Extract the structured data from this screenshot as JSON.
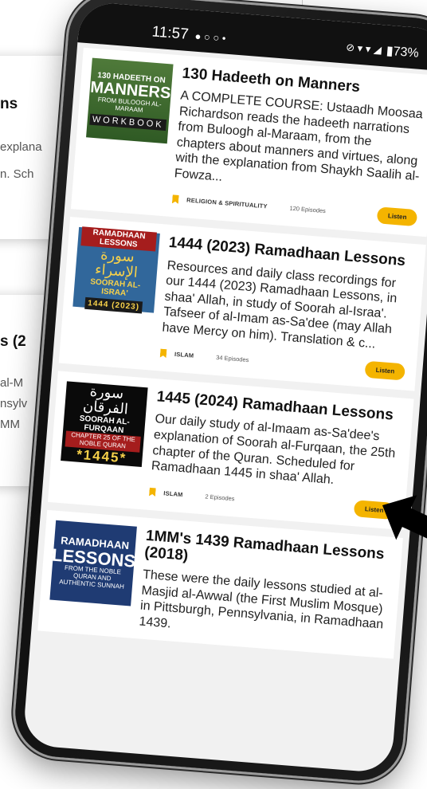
{
  "background": {
    "fragments": [
      "ns",
      "explana",
      "n. Sch",
      "s (2",
      "al-M",
      "nsylv",
      "MM"
    ]
  },
  "status_bar": {
    "time": "11:57",
    "left_icons": "● ○ ○ •",
    "right_icons": "⊘ ▾ ▾ ◢",
    "battery": "▮73%"
  },
  "podcasts": [
    {
      "thumb": {
        "style": "green",
        "line1": "130 HADEETH ON",
        "line2": "MANNERS",
        "line3": "FROM BULOOGH AL-MARAAM",
        "line4": "WORKBOOK"
      },
      "title": "130 Hadeeth on Manners",
      "description": "A COMPLETE COURSE: Ustaadh Moosaa Richardson reads the hadeeth narrations from Buloogh al-Maraam, from the chapters about manners and virtues, along with the explanation from Shaykh Saalih al-Fowza...",
      "category": "RELIGION & SPIRITUALITY",
      "episodes": "120 Episodes",
      "listen_label": "Listen"
    },
    {
      "thumb": {
        "style": "blue",
        "line1": "RAMADHAAN LESSONS",
        "line2": "سورة الإسراء",
        "line3": "SOORAH AL-ISRAA'",
        "line4": "1444 (2023)"
      },
      "title": "1444 (2023) Ramadhaan Lessons",
      "description": "Resources and daily class recordings for our 1444 (2023) Ramadhaan Lessons, in shaa' Allah, in study of Soorah al-Israa'. Tafseer of al-Imam as-Sa'dee (may Allah have Mercy on him). Translation & c...",
      "category": "ISLAM",
      "episodes": "34 Episodes",
      "listen_label": "Listen"
    },
    {
      "thumb": {
        "style": "black",
        "line1": "سورة الفرقان",
        "line2": "SOORAH AL-FURQAAN",
        "line3": "CHAPTER 25 OF THE NOBLE QURAN",
        "line4": "*1445*"
      },
      "title": "1445 (2024) Ramadhaan Lessons",
      "description": "Our daily study of al-Imaam as-Sa'dee's explanation of Soorah al-Furqaan, the 25th chapter of the Quran. Scheduled for Ramadhaan 1445 in shaa' Allah.",
      "category": "ISLAM",
      "episodes": "2 Episodes",
      "listen_label": "Listen"
    },
    {
      "thumb": {
        "style": "navy",
        "line1": "RAMADHAAN",
        "line2": "LESSONS",
        "line3": "FROM THE NOBLE QURAN AND AUTHENTIC SUNNAH",
        "line4": ""
      },
      "title": "1MM's 1439 Ramadhaan Lessons (2018)",
      "description": "These were the daily lessons studied at al-Masjid al-Awwal (the First Muslim Mosque) in Pittsburgh, Pennsylvania, in Ramadhaan 1439.",
      "category": "",
      "episodes": "",
      "listen_label": ""
    }
  ]
}
